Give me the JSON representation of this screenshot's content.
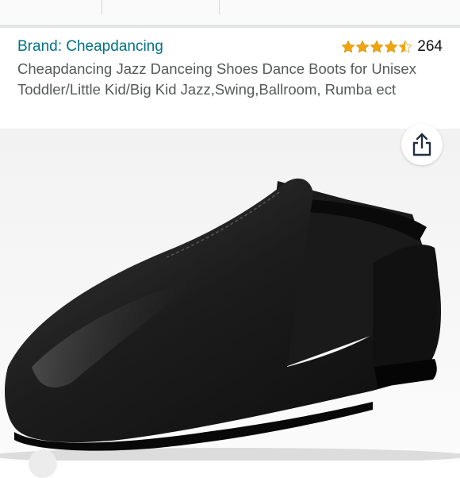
{
  "product": {
    "brand_label": "Brand: Cheapdancing",
    "title": "Cheapdancing Jazz Danceing Shoes Dance Boots for Unisex Toddler/Little Kid/Big Kid Jazz,Swing,Ballroom, Rumba ect",
    "rating": {
      "stars": 4.5,
      "count": "264",
      "star_color": "#f0a50e"
    },
    "image": {
      "subject": "black leather jazz slip-on dance shoe"
    },
    "actions": {
      "share_icon": "share-icon"
    }
  },
  "colors": {
    "link": "#007185",
    "text": "#565959",
    "count": "#0f1111"
  }
}
